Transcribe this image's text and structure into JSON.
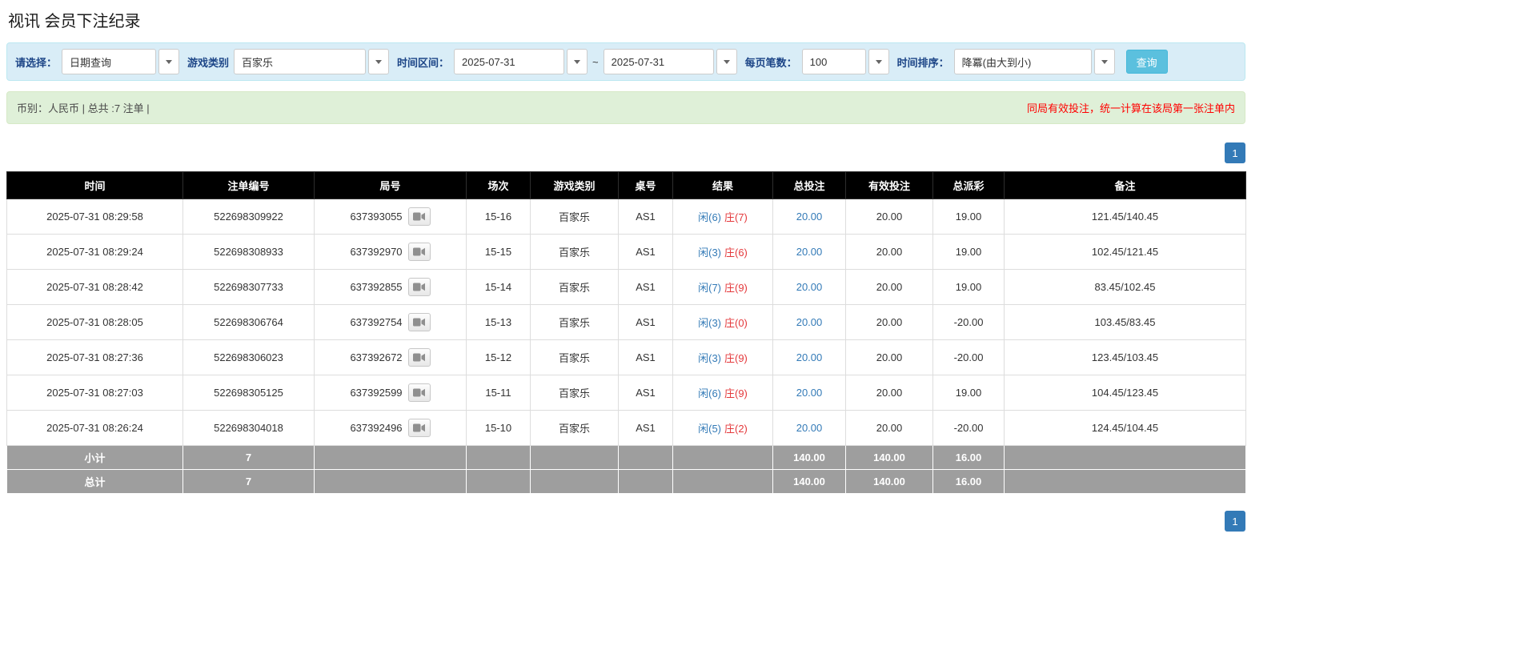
{
  "page": {
    "title": "视讯 会员下注纪录"
  },
  "filters": {
    "select_label": "请选择：",
    "select_value": "日期查询",
    "game_type_label": "游戏类别",
    "game_type_value": "百家乐",
    "date_range_label": "时间区间：",
    "date_from": "2025-07-31",
    "date_separator": "~",
    "date_to": "2025-07-31",
    "page_size_label": "每页笔数：",
    "page_size_value": "100",
    "sort_label": "时间排序：",
    "sort_value": "降冪(由大到小)",
    "search_button_label": "查询"
  },
  "info_bar": {
    "left_text": "币别：人民币 | 总共 :7 注单 |",
    "right_notice": "同局有效投注，统一计算在该局第一张注单内"
  },
  "pagination": {
    "page_label": "1"
  },
  "table": {
    "columns": [
      "时间",
      "注单编号",
      "局号",
      "场次",
      "游戏类别",
      "桌号",
      "结果",
      "总投注",
      "有效投注",
      "总派彩",
      "备注"
    ],
    "rows": [
      {
        "time": "2025-07-31 08:29:58",
        "bet_id": "522698309922",
        "round_id": "637393055",
        "session": "15-16",
        "game": "百家乐",
        "table_no": "AS1",
        "result_player": "闲(6)",
        "result_banker": "庄(7)",
        "total_bet": "20.00",
        "valid_bet": "20.00",
        "payout": "19.00",
        "remark": "121.45/140.45"
      },
      {
        "time": "2025-07-31 08:29:24",
        "bet_id": "522698308933",
        "round_id": "637392970",
        "session": "15-15",
        "game": "百家乐",
        "table_no": "AS1",
        "result_player": "闲(3)",
        "result_banker": "庄(6)",
        "total_bet": "20.00",
        "valid_bet": "20.00",
        "payout": "19.00",
        "remark": "102.45/121.45"
      },
      {
        "time": "2025-07-31 08:28:42",
        "bet_id": "522698307733",
        "round_id": "637392855",
        "session": "15-14",
        "game": "百家乐",
        "table_no": "AS1",
        "result_player": "闲(7)",
        "result_banker": "庄(9)",
        "total_bet": "20.00",
        "valid_bet": "20.00",
        "payout": "19.00",
        "remark": "83.45/102.45"
      },
      {
        "time": "2025-07-31 08:28:05",
        "bet_id": "522698306764",
        "round_id": "637392754",
        "session": "15-13",
        "game": "百家乐",
        "table_no": "AS1",
        "result_player": "闲(3)",
        "result_banker": "庄(0)",
        "total_bet": "20.00",
        "valid_bet": "20.00",
        "payout": "-20.00",
        "remark": "103.45/83.45"
      },
      {
        "time": "2025-07-31 08:27:36",
        "bet_id": "522698306023",
        "round_id": "637392672",
        "session": "15-12",
        "game": "百家乐",
        "table_no": "AS1",
        "result_player": "闲(3)",
        "result_banker": "庄(9)",
        "total_bet": "20.00",
        "valid_bet": "20.00",
        "payout": "-20.00",
        "remark": "123.45/103.45"
      },
      {
        "time": "2025-07-31 08:27:03",
        "bet_id": "522698305125",
        "round_id": "637392599",
        "session": "15-11",
        "game": "百家乐",
        "table_no": "AS1",
        "result_player": "闲(6)",
        "result_banker": "庄(9)",
        "total_bet": "20.00",
        "valid_bet": "20.00",
        "payout": "19.00",
        "remark": "104.45/123.45"
      },
      {
        "time": "2025-07-31 08:26:24",
        "bet_id": "522698304018",
        "round_id": "637392496",
        "session": "15-10",
        "game": "百家乐",
        "table_no": "AS1",
        "result_player": "闲(5)",
        "result_banker": "庄(2)",
        "total_bet": "20.00",
        "valid_bet": "20.00",
        "payout": "-20.00",
        "remark": "124.45/104.45"
      }
    ],
    "subtotal": {
      "label": "小计",
      "count": "7",
      "total_bet": "140.00",
      "valid_bet": "140.00",
      "payout": "16.00"
    },
    "total": {
      "label": "总计",
      "count": "7",
      "total_bet": "140.00",
      "valid_bet": "140.00",
      "payout": "16.00"
    }
  },
  "colors": {
    "accent_blue": "#337ab7",
    "result_player_blue": "#337ab7",
    "result_banker_red": "#e4393c",
    "negative_red": "#ff0000",
    "table_header_bg": "#000000",
    "summary_row_bg": "#9e9e9e",
    "filter_bar_bg": "#d9edf7",
    "info_bar_bg": "#dff0d8",
    "query_button_bg": "#5bc0de"
  }
}
